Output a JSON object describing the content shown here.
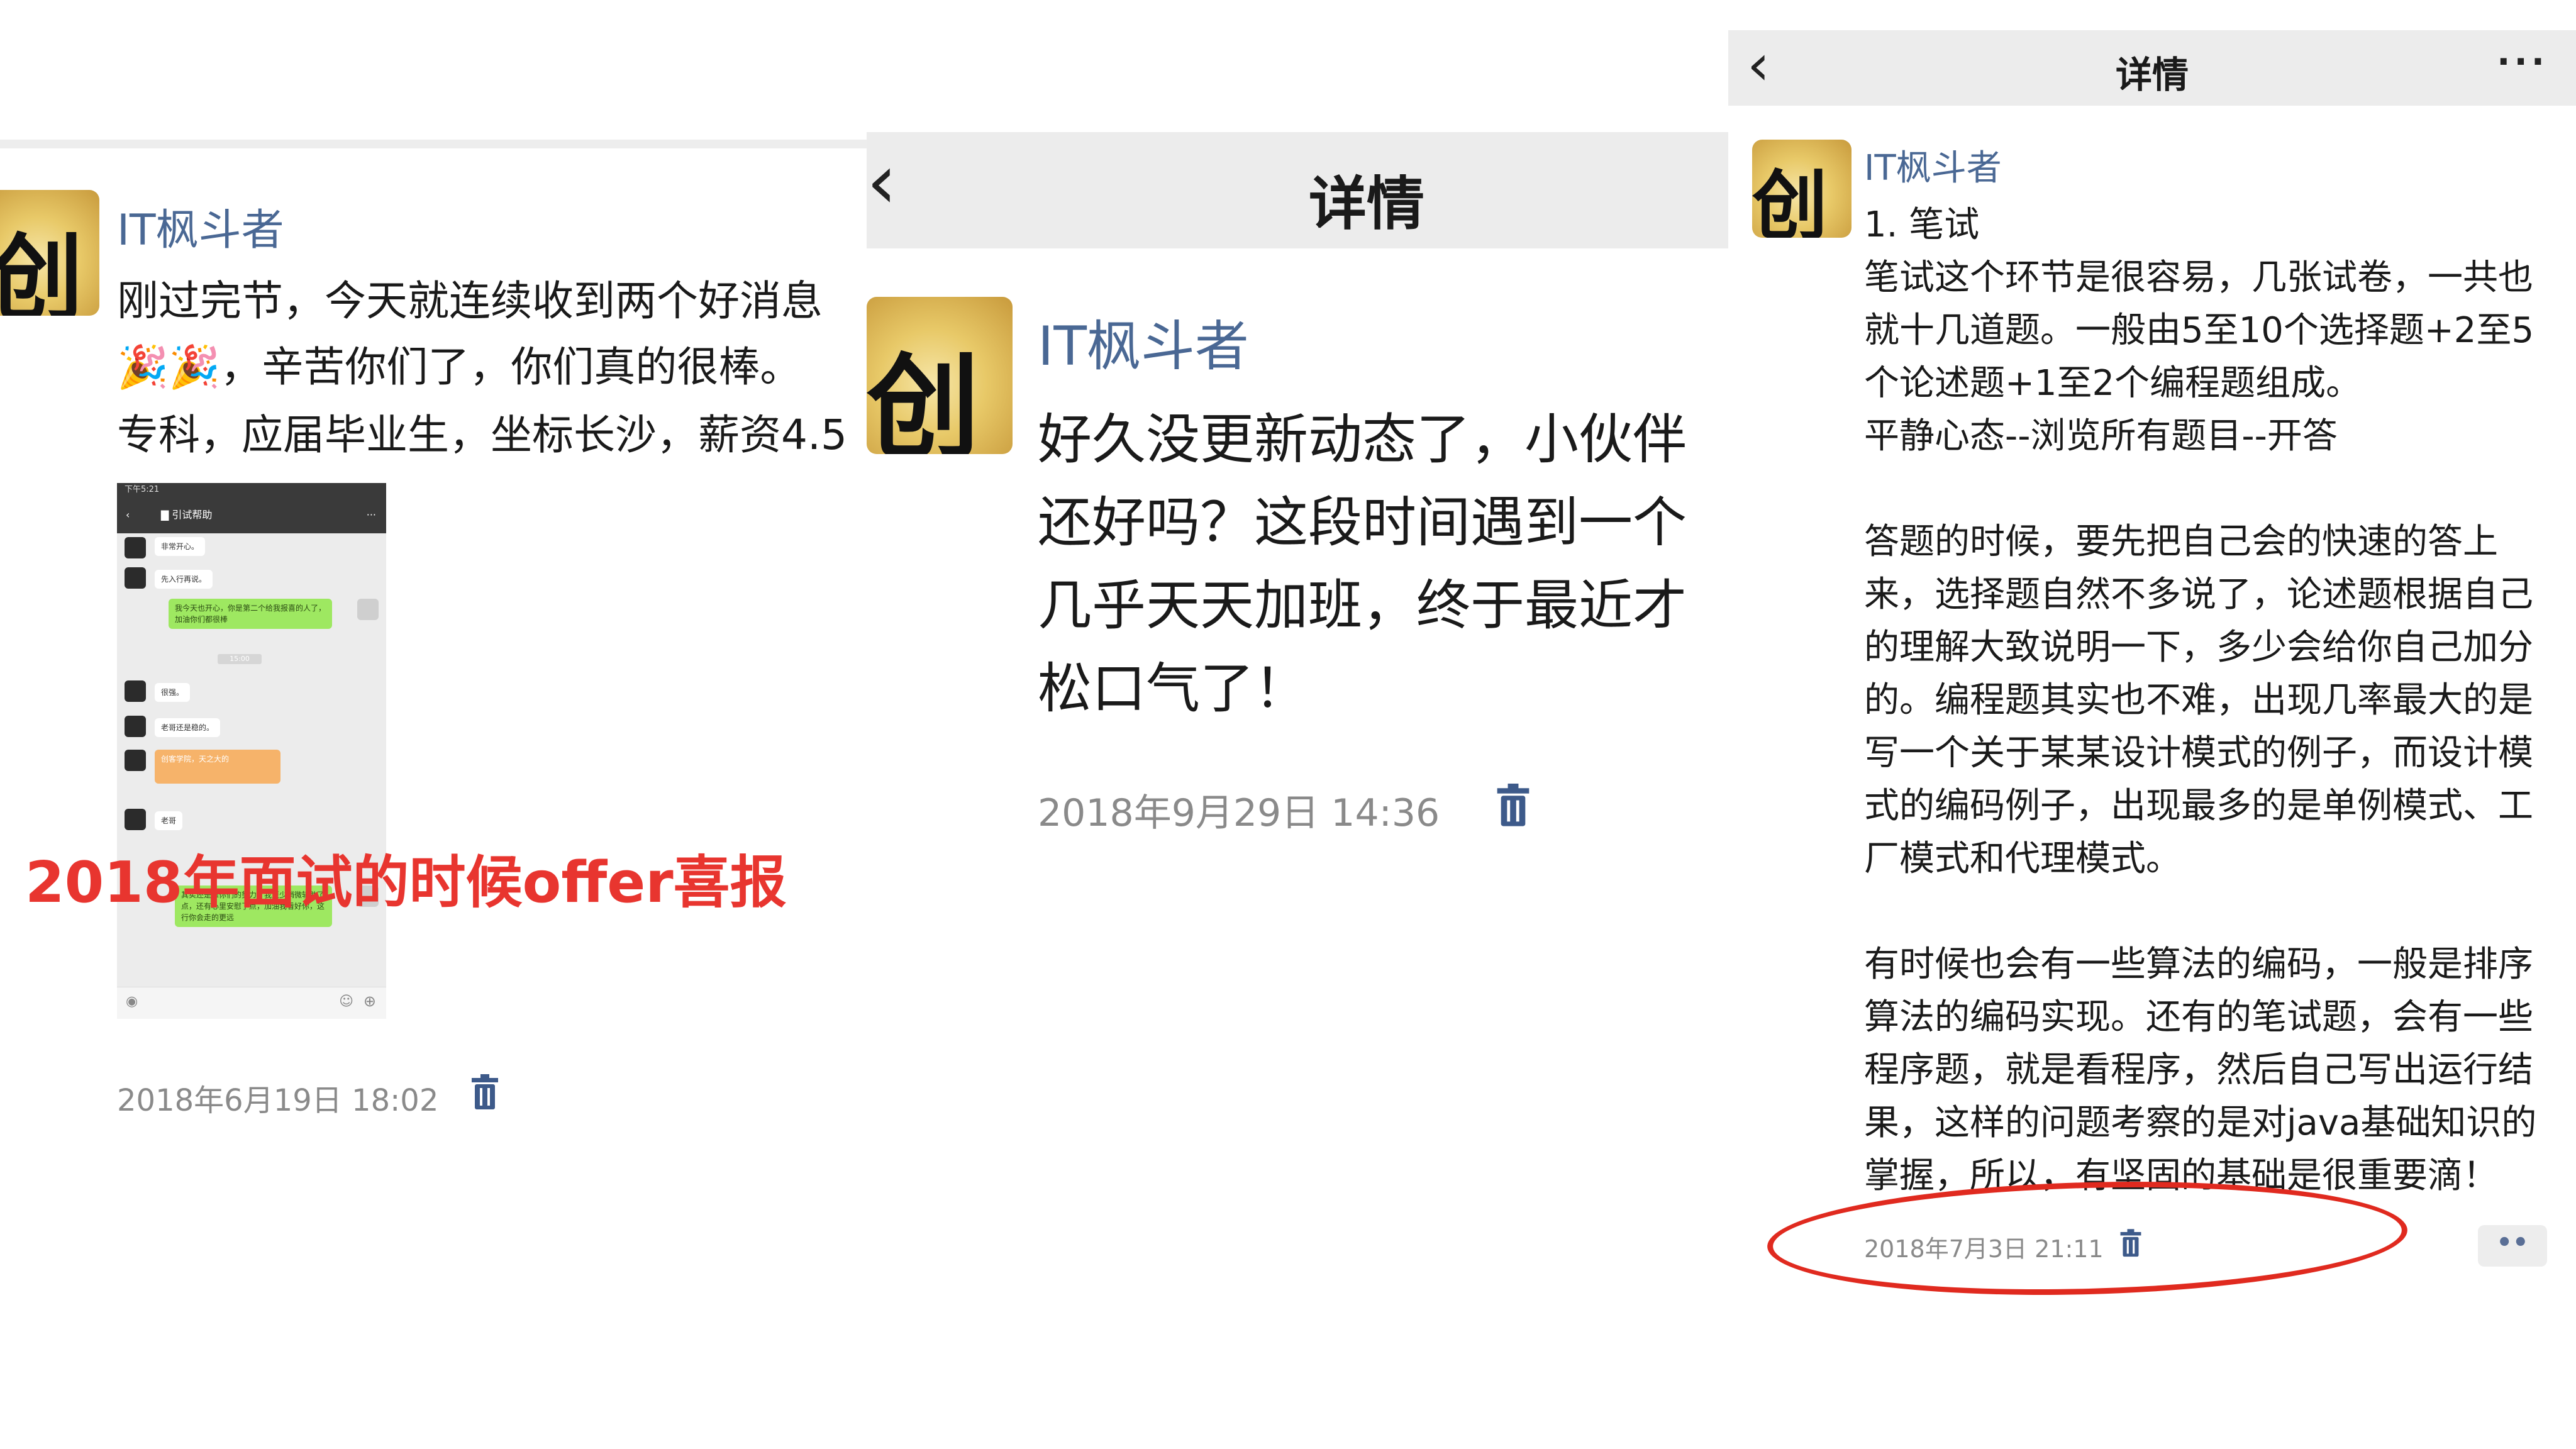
{
  "panel1": {
    "author": "IT枫斗者",
    "lines": [
      "刚过完节，今天就连续收到两个好消息",
      "🎉🎉，辛苦你们了，你们真的很棒。",
      "专科，应届毕业生，坐标长沙，薪资4.5"
    ],
    "overlay_text": "2018年面试的时候offer喜报",
    "timestamp": "2018年6月19日 18:02",
    "screenshot": {
      "status_text": "下午5:21",
      "chat_title": "▇ 引试帮助",
      "messages": [
        "非常开心。",
        "先入行再说。",
        "我今天也开心，你是第二个给我报喜的人了，加油你们都很棒",
        "很强。",
        "老哥还是稳的。",
        "创客学院，天之大的",
        "老哥",
        "其实还是靠你们的努力，我至少稍微辅助了点，还有心里安慰了点，加油我看好你，这行你会走的更远"
      ],
      "pill_text": "15:00"
    }
  },
  "panel2": {
    "nav_title": "详情",
    "author": "IT枫斗者",
    "lines": [
      "好久没更新动态了，小伙伴",
      "还好吗？这段时间遇到一个",
      "几乎天天加班，终于最近才",
      "松口气了！"
    ],
    "timestamp": "2018年9月29日 14:36"
  },
  "panel3": {
    "nav_title": "详情",
    "more_label": "···",
    "author": "IT枫斗者",
    "lines": [
      "1. 笔试",
      "笔试这个环节是很容易，几张试卷，一共也",
      "就十几道题。一般由5至10个选择题+2至5",
      "个论述题+1至2个编程题组成。",
      "平静心态--浏览所有题目--开答",
      "",
      "答题的时候，要先把自己会的快速的答上",
      "来，选择题自然不多说了，论述题根据自己",
      "的理解大致说明一下，多少会给你自己加分",
      "的。编程题其实也不难，出现几率最大的是",
      "写一个关于某某设计模式的例子，而设计模",
      "式的编码例子，出现最多的是单例模式、工",
      "厂模式和代理模式。",
      "",
      "有时候也会有一些算法的编码，一般是排序",
      "算法的编码实现。还有的笔试题，会有一些",
      "程序题，就是看程序，然后自己写出运行结",
      "果，这样的问题考察的是对java基础知识的",
      "掌握，所以，有坚固的基础是很重要滴！"
    ],
    "timestamp": "2018年7月3日 21:11",
    "dots_label": "••"
  },
  "avatar_glyph": "创",
  "colors": {
    "name_blue": "#4a6894",
    "annotation_red": "#e02a1f",
    "overlay_red": "#e8352f",
    "trash_blue": "#3d5a8a"
  }
}
